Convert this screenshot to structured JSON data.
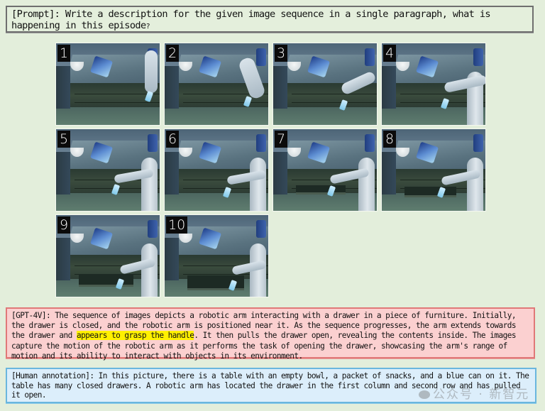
{
  "prompt": {
    "text": "[Prompt]: Write a description for the given image sequence in a single paragraph, what is happening in this episode",
    "end_mark": "?"
  },
  "frames": [
    {
      "number": "1",
      "arm_state": "arm above near drawer, drawers closed"
    },
    {
      "number": "2",
      "arm_state": "arm descending toward drawers"
    },
    {
      "number": "3",
      "arm_state": "arm extends toward drawer"
    },
    {
      "number": "4",
      "arm_state": "arm approaching handle"
    },
    {
      "number": "5",
      "arm_state": "arm at handle"
    },
    {
      "number": "6",
      "arm_state": "arm grasping handle"
    },
    {
      "number": "7",
      "arm_state": "arm beginning to pull"
    },
    {
      "number": "8",
      "arm_state": "arm pulling drawer"
    },
    {
      "number": "9",
      "arm_state": "drawer partly open"
    },
    {
      "number": "10",
      "arm_state": "drawer pulled open"
    }
  ],
  "gpt4v": {
    "label": "[GPT-4V]",
    "text_before": ": The sequence of images depicts a robotic arm interacting with a drawer in a piece of furniture. Initially, the drawer is closed, and the robotic arm is positioned near it. As the sequence progresses, the arm extends towards the drawer and ",
    "highlight": "appears to grasp the handle",
    "text_after": ". It then pulls the drawer open, revealing the contents inside. The images capture the motion of the robotic arm as it performs the task of opening the drawer, showcasing the arm's range of motion and its ability to interact with objects in its environment.",
    "highlight_color": "#fff000"
  },
  "human": {
    "label": "[Human annotation]",
    "text": ": In this picture, there is a table with an empty bowl, a packet of snacks, and a blue can on it. The table has many closed drawers. A robotic arm has located the drawer in the first column and second row and has pulled it open."
  },
  "watermark": {
    "icon": "wechat-icon",
    "text": "公众号 · 新智元"
  },
  "colors": {
    "background": "#e3eedb",
    "gpt_box": "#fbd0d0",
    "gpt_border": "#e07878",
    "human_box": "#dceefb",
    "human_border": "#6ab6de",
    "prompt_border": "#6f6f6f"
  }
}
